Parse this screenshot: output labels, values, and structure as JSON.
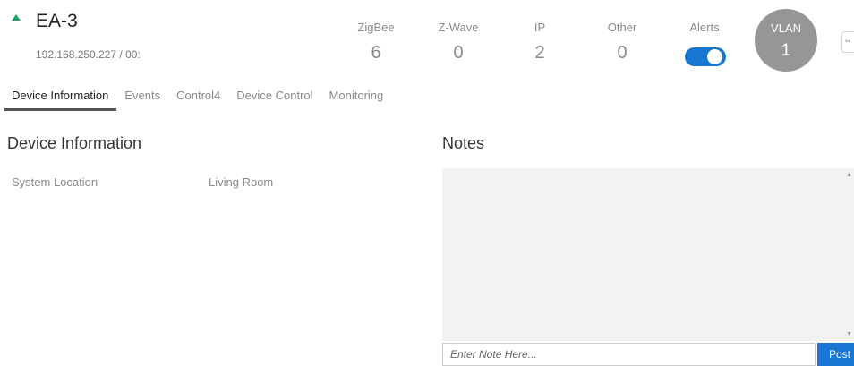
{
  "device": {
    "name": "EA-3",
    "address": "192.168.250.227 / 00:",
    "status_color": "#1aa366"
  },
  "stats": [
    {
      "label": "ZigBee",
      "value": "6"
    },
    {
      "label": "Z-Wave",
      "value": "0"
    },
    {
      "label": "IP",
      "value": "2"
    },
    {
      "label": "Other",
      "value": "0"
    }
  ],
  "alerts": {
    "label": "Alerts",
    "enabled": true,
    "color": "#1976d2"
  },
  "vlan": {
    "label": "VLAN",
    "value": "1"
  },
  "tabs": [
    {
      "label": "Device Information",
      "active": true
    },
    {
      "label": "Events",
      "active": false
    },
    {
      "label": "Control4",
      "active": false
    },
    {
      "label": "Device Control",
      "active": false
    },
    {
      "label": "Monitoring",
      "active": false
    }
  ],
  "device_info": {
    "title": "Device Information",
    "fields": [
      {
        "label": "System Location",
        "value": "Living Room"
      }
    ]
  },
  "notes": {
    "title": "Notes",
    "input_placeholder": "Enter Note Here...",
    "post_label": "Post"
  }
}
